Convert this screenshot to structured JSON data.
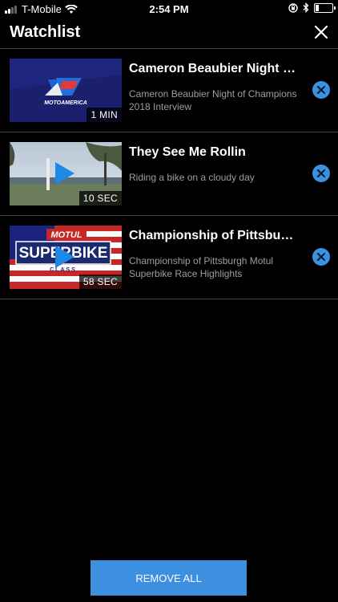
{
  "status_bar": {
    "carrier": "T-Mobile",
    "time": "2:54 PM"
  },
  "header": {
    "title": "Watchlist",
    "close_icon": "close-icon"
  },
  "items": [
    {
      "title": "Cameron Beaubier Night of...",
      "description": "Cameron Beaubier Night of Champions 2018 Interview",
      "duration": "1 MIN",
      "thumb_logo_text": "MOTOAMERICA"
    },
    {
      "title": "They See Me Rollin",
      "description": "Riding a bike on a cloudy day",
      "duration": "10 SEC"
    },
    {
      "title": "Championship of Pittsburgh...",
      "description": "Championship of Pittsburgh Motul Superbike Race Highlights",
      "duration": "58 SEC",
      "thumb_logo_text": "MOTUL",
      "thumb_headline": "SUPERBIKE",
      "thumb_subline": "CLASS"
    }
  ],
  "footer": {
    "remove_all_label": "REMOVE ALL"
  },
  "colors": {
    "accent": "#3d8fe0",
    "background": "#000000",
    "divider": "#4a4a4a",
    "secondary_text": "#9e9e9e"
  }
}
